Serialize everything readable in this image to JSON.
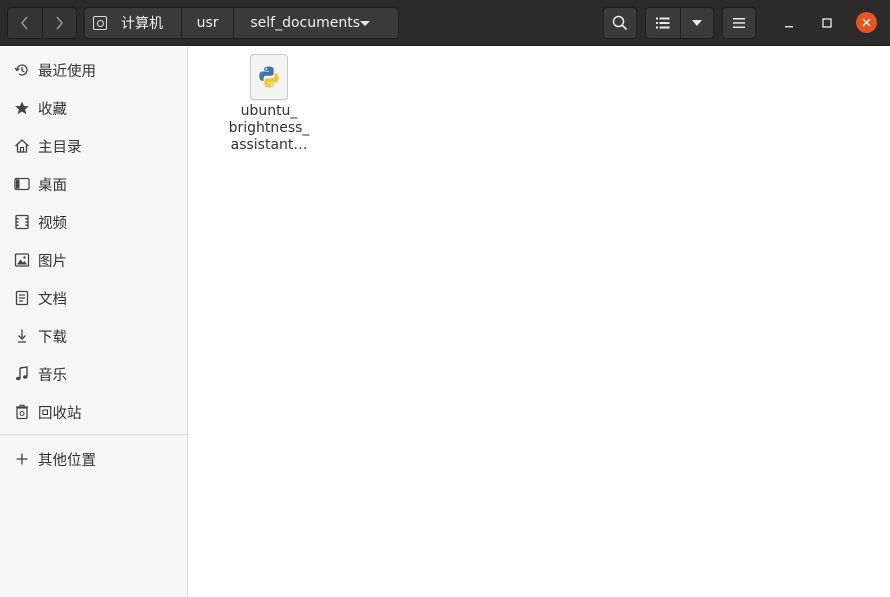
{
  "header": {
    "path": [
      {
        "label": "计算机",
        "icon": "disk-icon"
      },
      {
        "label": "usr"
      },
      {
        "label": "self_documents"
      }
    ]
  },
  "sidebar": {
    "items": [
      {
        "label": "最近使用",
        "icon": "recent-icon"
      },
      {
        "label": "收藏",
        "icon": "star-icon"
      },
      {
        "label": "主目录",
        "icon": "home-icon"
      },
      {
        "label": "桌面",
        "icon": "desktop-icon"
      },
      {
        "label": "视频",
        "icon": "video-icon"
      },
      {
        "label": "图片",
        "icon": "picture-icon"
      },
      {
        "label": "文档",
        "icon": "document-icon"
      },
      {
        "label": "下载",
        "icon": "download-icon"
      },
      {
        "label": "音乐",
        "icon": "music-icon"
      },
      {
        "label": "回收站",
        "icon": "trash-icon"
      }
    ],
    "other_locations": {
      "label": "其他位置",
      "icon": "plus-icon"
    }
  },
  "files": [
    {
      "name_line1": "ubuntu_",
      "name_line2": "brightness_",
      "name_line3": "assistant…",
      "icon": "python-file-icon"
    }
  ],
  "colors": {
    "accent": "#e95420",
    "header_bg": "#2b2b2b",
    "sidebar_bg": "#f6f6f6"
  }
}
